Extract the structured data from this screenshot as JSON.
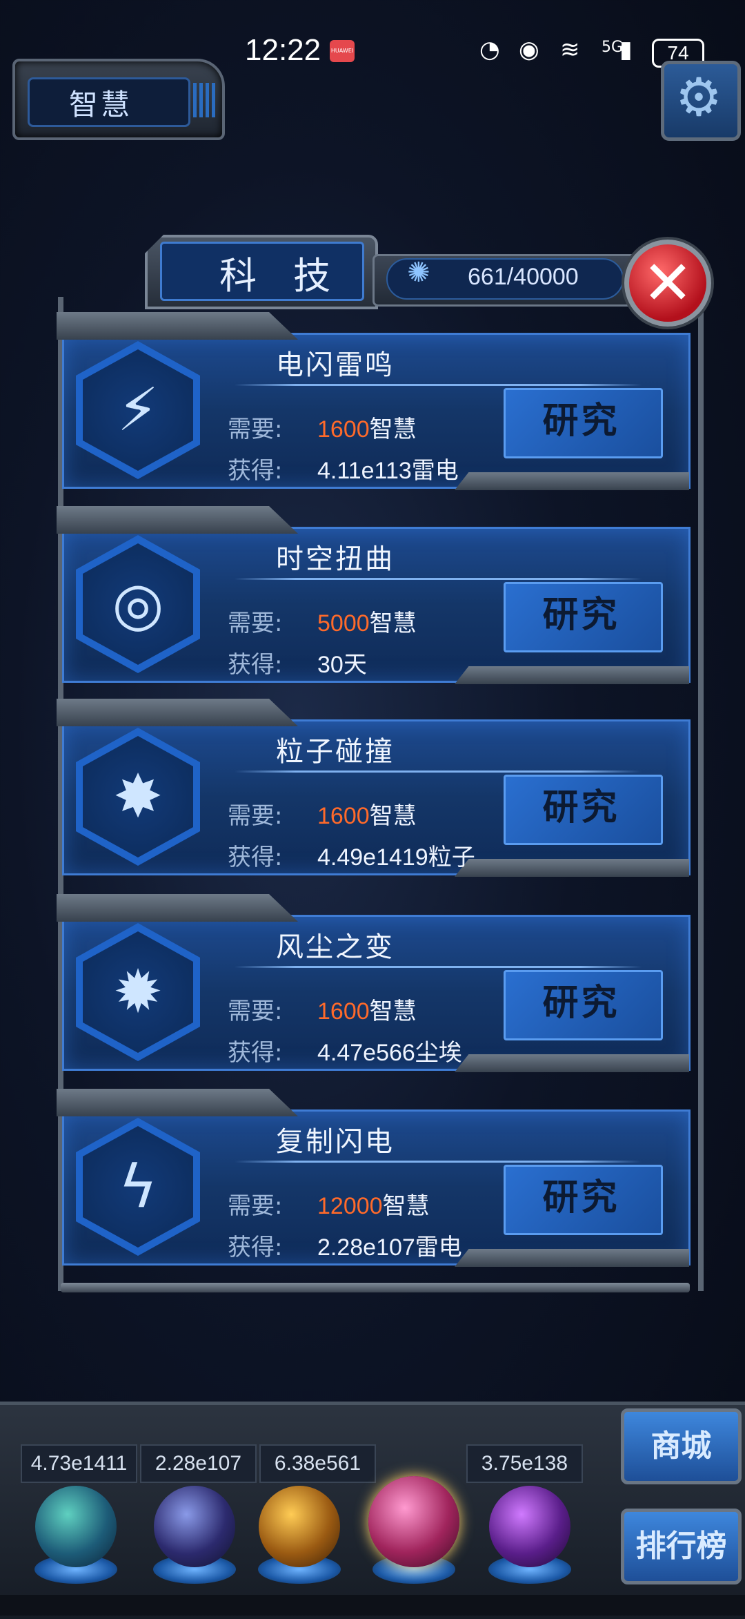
{
  "status_bar": {
    "time": "12:22",
    "notif_badge": "HUAWEI",
    "battery": "74",
    "network": "5G"
  },
  "top_left": {
    "title": "智慧"
  },
  "panel": {
    "title": "科 技",
    "resource": "661/40000"
  },
  "cards": [
    {
      "name": "电闪雷鸣",
      "need_label": "需要:",
      "need_num": "1600",
      "need_unit": "智慧",
      "gain_label": "获得:",
      "gain": "4.11e113雷电",
      "button": "研究",
      "icon": "lightning-strike-icon"
    },
    {
      "name": "时空扭曲",
      "need_label": "需要:",
      "need_num": "5000",
      "need_unit": "智慧",
      "gain_label": "获得:",
      "gain": "30天",
      "button": "研究",
      "icon": "vortex-icon"
    },
    {
      "name": "粒子碰撞",
      "need_label": "需要:",
      "need_num": "1600",
      "need_unit": "智慧",
      "gain_label": "获得:",
      "gain": "4.49e1419粒子",
      "button": "研究",
      "icon": "particle-collision-icon"
    },
    {
      "name": "风尘之变",
      "need_label": "需要:",
      "need_num": "1600",
      "need_unit": "智慧",
      "gain_label": "获得:",
      "gain": "4.47e566尘埃",
      "button": "研究",
      "icon": "dust-burst-icon"
    },
    {
      "name": "复制闪电",
      "need_label": "需要:",
      "need_num": "12000",
      "need_unit": "智慧",
      "gain_label": "获得:",
      "gain": "2.28e107雷电",
      "button": "研究",
      "icon": "copy-lightning-icon"
    }
  ],
  "tray": {
    "counters": [
      "4.73e1411",
      "2.28e107",
      "6.38e561",
      "3.75e138"
    ],
    "shop": "商城",
    "ranking": "排行榜"
  }
}
